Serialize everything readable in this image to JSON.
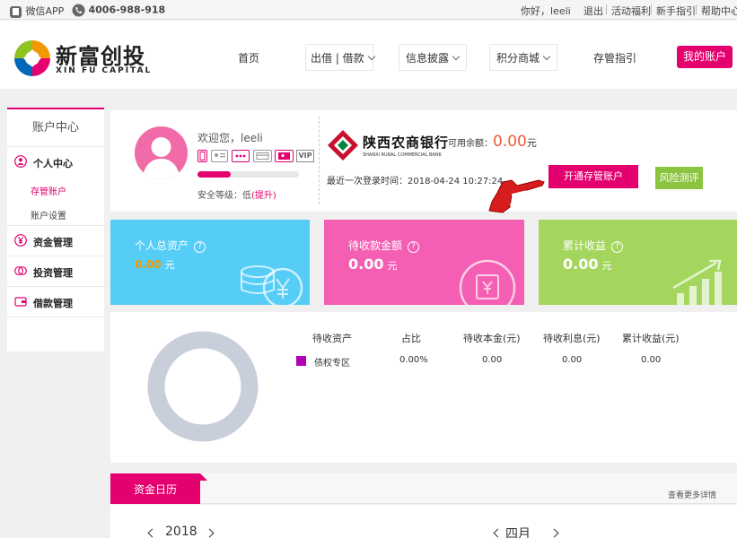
{
  "topbar": {
    "wechat_app": "微信APP",
    "phone": "4006-988-918",
    "greeting": "你好，leeli",
    "logout": "退出",
    "activity": "活动福利",
    "newbie": "新手指引",
    "help": "帮助中心"
  },
  "brand": {
    "name": "新富创投",
    "sub": "XIN FU CAPITAL"
  },
  "nav": {
    "home": "首页",
    "lend": "出借 | 借款",
    "disclosure": "信息披露",
    "points": "积分商城",
    "custody": "存管指引",
    "my_account": "我的账户"
  },
  "sidebar": {
    "title": "账户中心",
    "personal": "个人中心",
    "custody_account": "存管账户",
    "account_settings": "账户设置",
    "funds": "资金管理",
    "invest": "投资管理",
    "loan": "借款管理"
  },
  "profile": {
    "welcome": "欢迎您，leeli",
    "vip": "VIP",
    "security_level": "安全等级：低",
    "improve": "(提升)",
    "security_progress": 0.33
  },
  "bank": {
    "name_cn": "陕西农商银行",
    "name_en": "SHANXI RURAL COMMERCIAL BANK",
    "balance_label": "可用余额：",
    "balance_value": "0.00",
    "balance_unit": "元",
    "last_login": "最近一次登录时间：2018-04-24 10:27:24",
    "open_custody": "开通存管账户",
    "risk_test": "风险测评"
  },
  "stats": [
    {
      "title": "个人总资产",
      "value": "0.00",
      "unit": "元",
      "color": "#55cdf7"
    },
    {
      "title": "待收款金额",
      "value": "0.00",
      "unit": "元",
      "color": "#f45fb4"
    },
    {
      "title": "累计收益",
      "value": "0.00",
      "unit": "元",
      "color": "#a4d65e"
    }
  ],
  "assets_table": {
    "headers": [
      "待收资产",
      "占比",
      "待收本金(元)",
      "待收利息(元)",
      "累计收益(元)"
    ],
    "row": {
      "name": "债权专区",
      "ratio": "0.00%",
      "principal": "0.00",
      "interest": "0.00",
      "earnings": "0.00",
      "color": "#b400b4"
    }
  },
  "calendar": {
    "tab": "资金日历",
    "more": "查看更多详情",
    "year": "2018",
    "month": "四月"
  },
  "colors": {
    "accent": "#e4006f",
    "green": "#8bc43f"
  }
}
